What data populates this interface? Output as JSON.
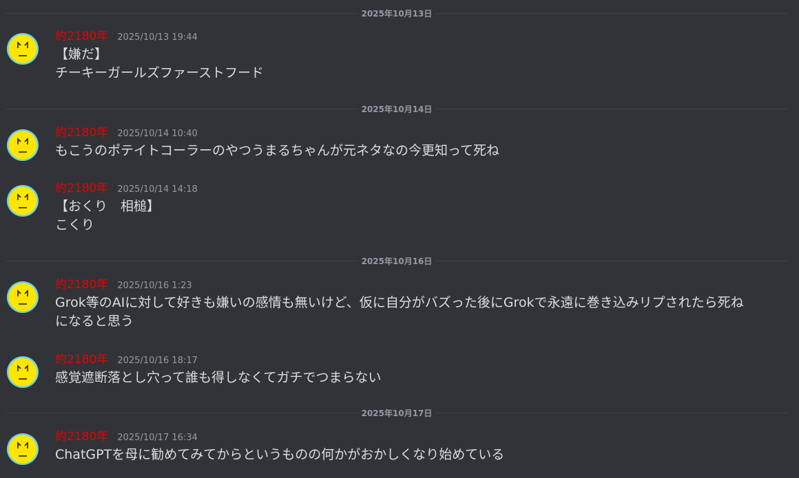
{
  "dividers": [
    {
      "label": "2025年10月13日"
    },
    {
      "label": "2025年10月14日"
    },
    {
      "label": "2025年10月16日"
    },
    {
      "label": "2025年10月17日"
    }
  ],
  "messages": [
    {
      "username": "約2180年",
      "timestamp": "2025/10/13 19:44",
      "lines": [
        "【嫌だ】",
        "チーキーガールズファーストフード"
      ]
    },
    {
      "username": "約2180年",
      "timestamp": "2025/10/14 10:40",
      "lines": [
        "もこうのポテイトコーラーのやつうまるちゃんが元ネタなの今更知って死ね"
      ]
    },
    {
      "username": "約2180年",
      "timestamp": "2025/10/14 14:18",
      "lines": [
        "【おくり　相槌】",
        "こくり"
      ]
    },
    {
      "username": "約2180年",
      "timestamp": "2025/10/16 1:23",
      "lines": [
        "Grok等のAIに対して好きも嫌いの感情も無いけど、仮に自分がバズった後にGrokで永遠に巻き込みリプされたら死ね",
        "になると思う"
      ]
    },
    {
      "username": "約2180年",
      "timestamp": "2025/10/16 18:17",
      "lines": [
        "感覚遮断落とし穴って誰も得しなくてガチでつまらない"
      ]
    },
    {
      "username": "約2180年",
      "timestamp": "2025/10/17 16:34",
      "lines": [
        "ChatGPTを母に勧めてみてからというものの何かがおかしくなり始めている"
      ]
    }
  ],
  "colors": {
    "background": "#313338",
    "username": "#e10600",
    "timestamp": "#949ba4",
    "message_text": "#dbdee1",
    "avatar_fill": "#ffe600",
    "avatar_ring": "#6fd3e6"
  },
  "icons": {
    "avatar": "yellow-face-avatar-icon"
  }
}
